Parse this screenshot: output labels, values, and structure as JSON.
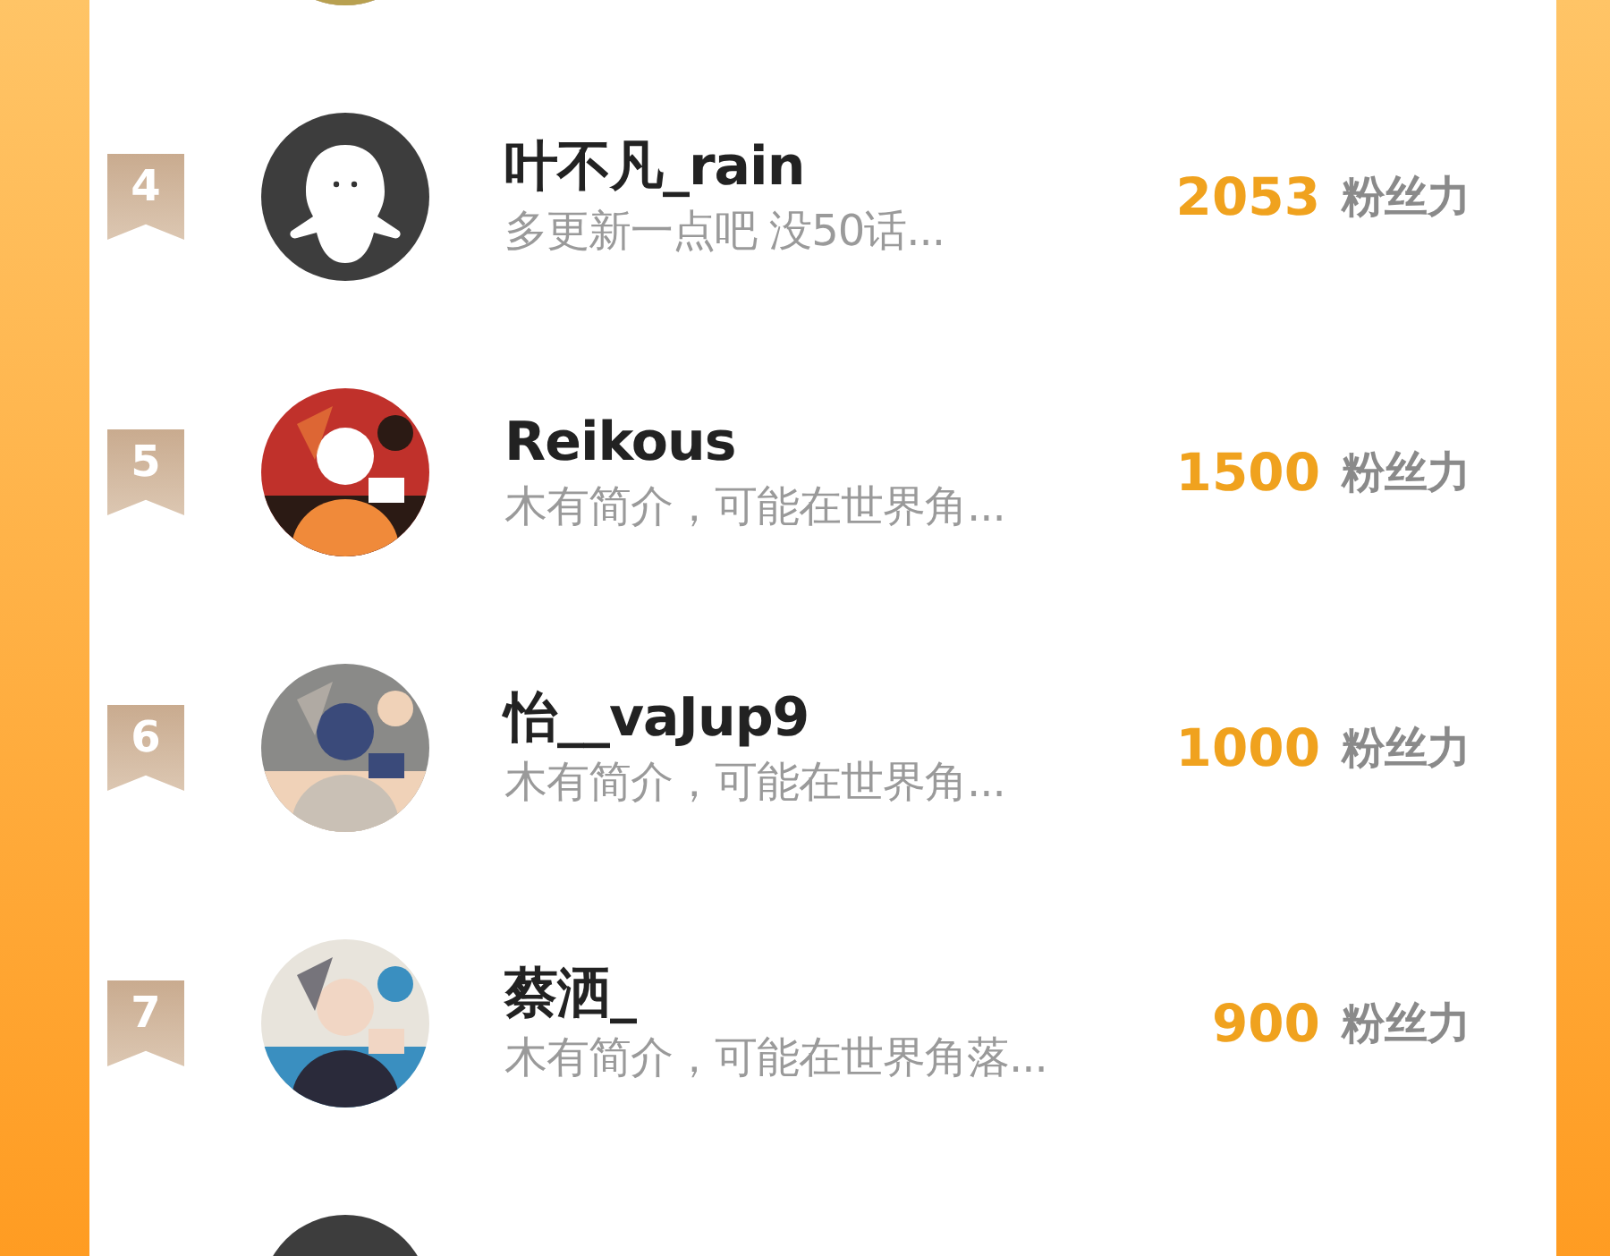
{
  "ranking": [
    {
      "rank": "4",
      "avatar": {
        "kind": "silhouette"
      },
      "name": "叶不凡_rain",
      "bio": "多更新一点吧 没50话...",
      "score": "2053",
      "unit": "粉丝力"
    },
    {
      "rank": "5",
      "name": "Reikous",
      "bio": "木有简介，可能在世界角...",
      "score": "1500",
      "unit": "粉丝力"
    },
    {
      "rank": "6",
      "name": "怡__vaJup9",
      "bio": "木有简介，可能在世界角...",
      "score": "1000",
      "unit": "粉丝力"
    },
    {
      "rank": "7",
      "name": "蔡洒_",
      "bio": "木有简介，可能在世界角落...",
      "score": "900",
      "unit": "粉丝力"
    }
  ]
}
